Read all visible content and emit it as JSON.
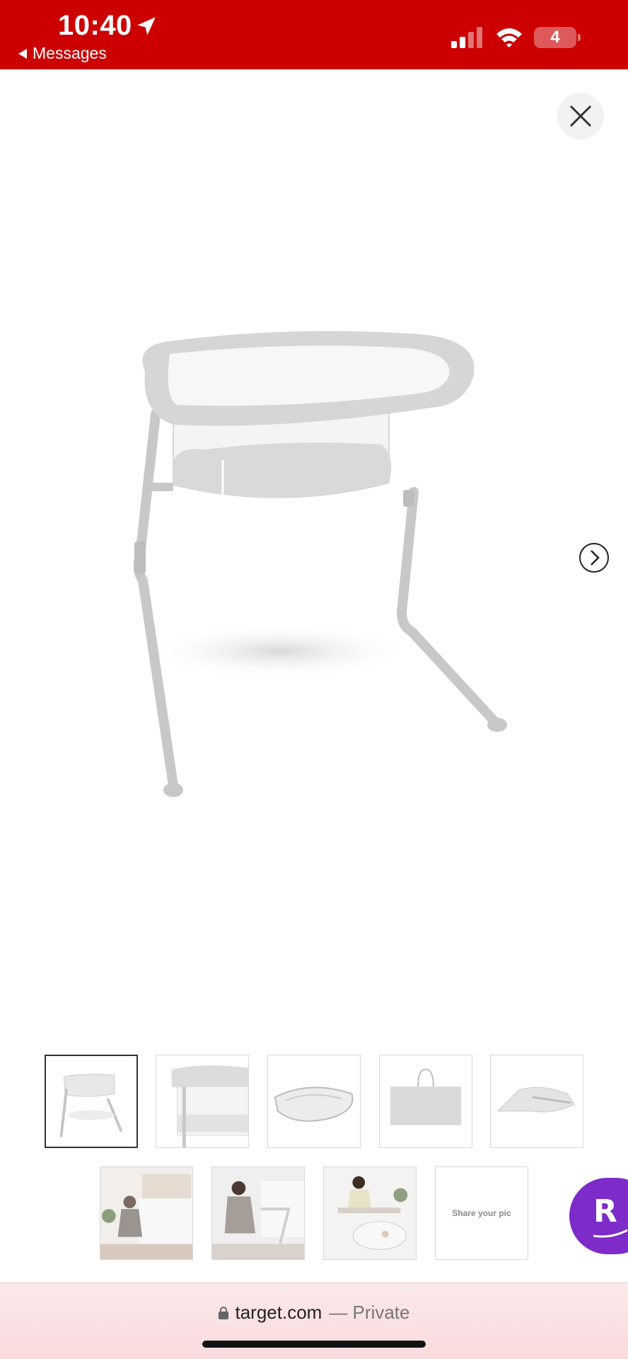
{
  "status_bar": {
    "time": "10:40",
    "back_label": "Messages",
    "battery_level": "4",
    "background_color": "#cc0000",
    "icons": [
      "location-arrow-icon",
      "cellular-signal-icon",
      "wifi-icon",
      "battery-icon"
    ]
  },
  "viewer": {
    "close_icon": "close-icon",
    "next_icon": "chevron-right-circle-icon",
    "main_image": "bassinet-product-image"
  },
  "thumbnails": {
    "row1": [
      {
        "name": "bassinet-full-view",
        "selected": true
      },
      {
        "name": "bassinet-closeup",
        "selected": false
      },
      {
        "name": "bassinet-folded",
        "selected": false
      },
      {
        "name": "travel-bag",
        "selected": false
      },
      {
        "name": "bassinet-frame-parts",
        "selected": false
      }
    ],
    "row2": [
      {
        "name": "woman-assembling-bassinet",
        "selected": false
      },
      {
        "name": "woman-adjusting-bassinet",
        "selected": false
      },
      {
        "name": "woman-with-baby-in-bassinet",
        "selected": false
      }
    ],
    "share_label": "Share your pic"
  },
  "rakuten": {
    "letter": "R",
    "color": "#7d2bc9"
  },
  "browser": {
    "domain": "target.com",
    "mode": "— Private"
  }
}
